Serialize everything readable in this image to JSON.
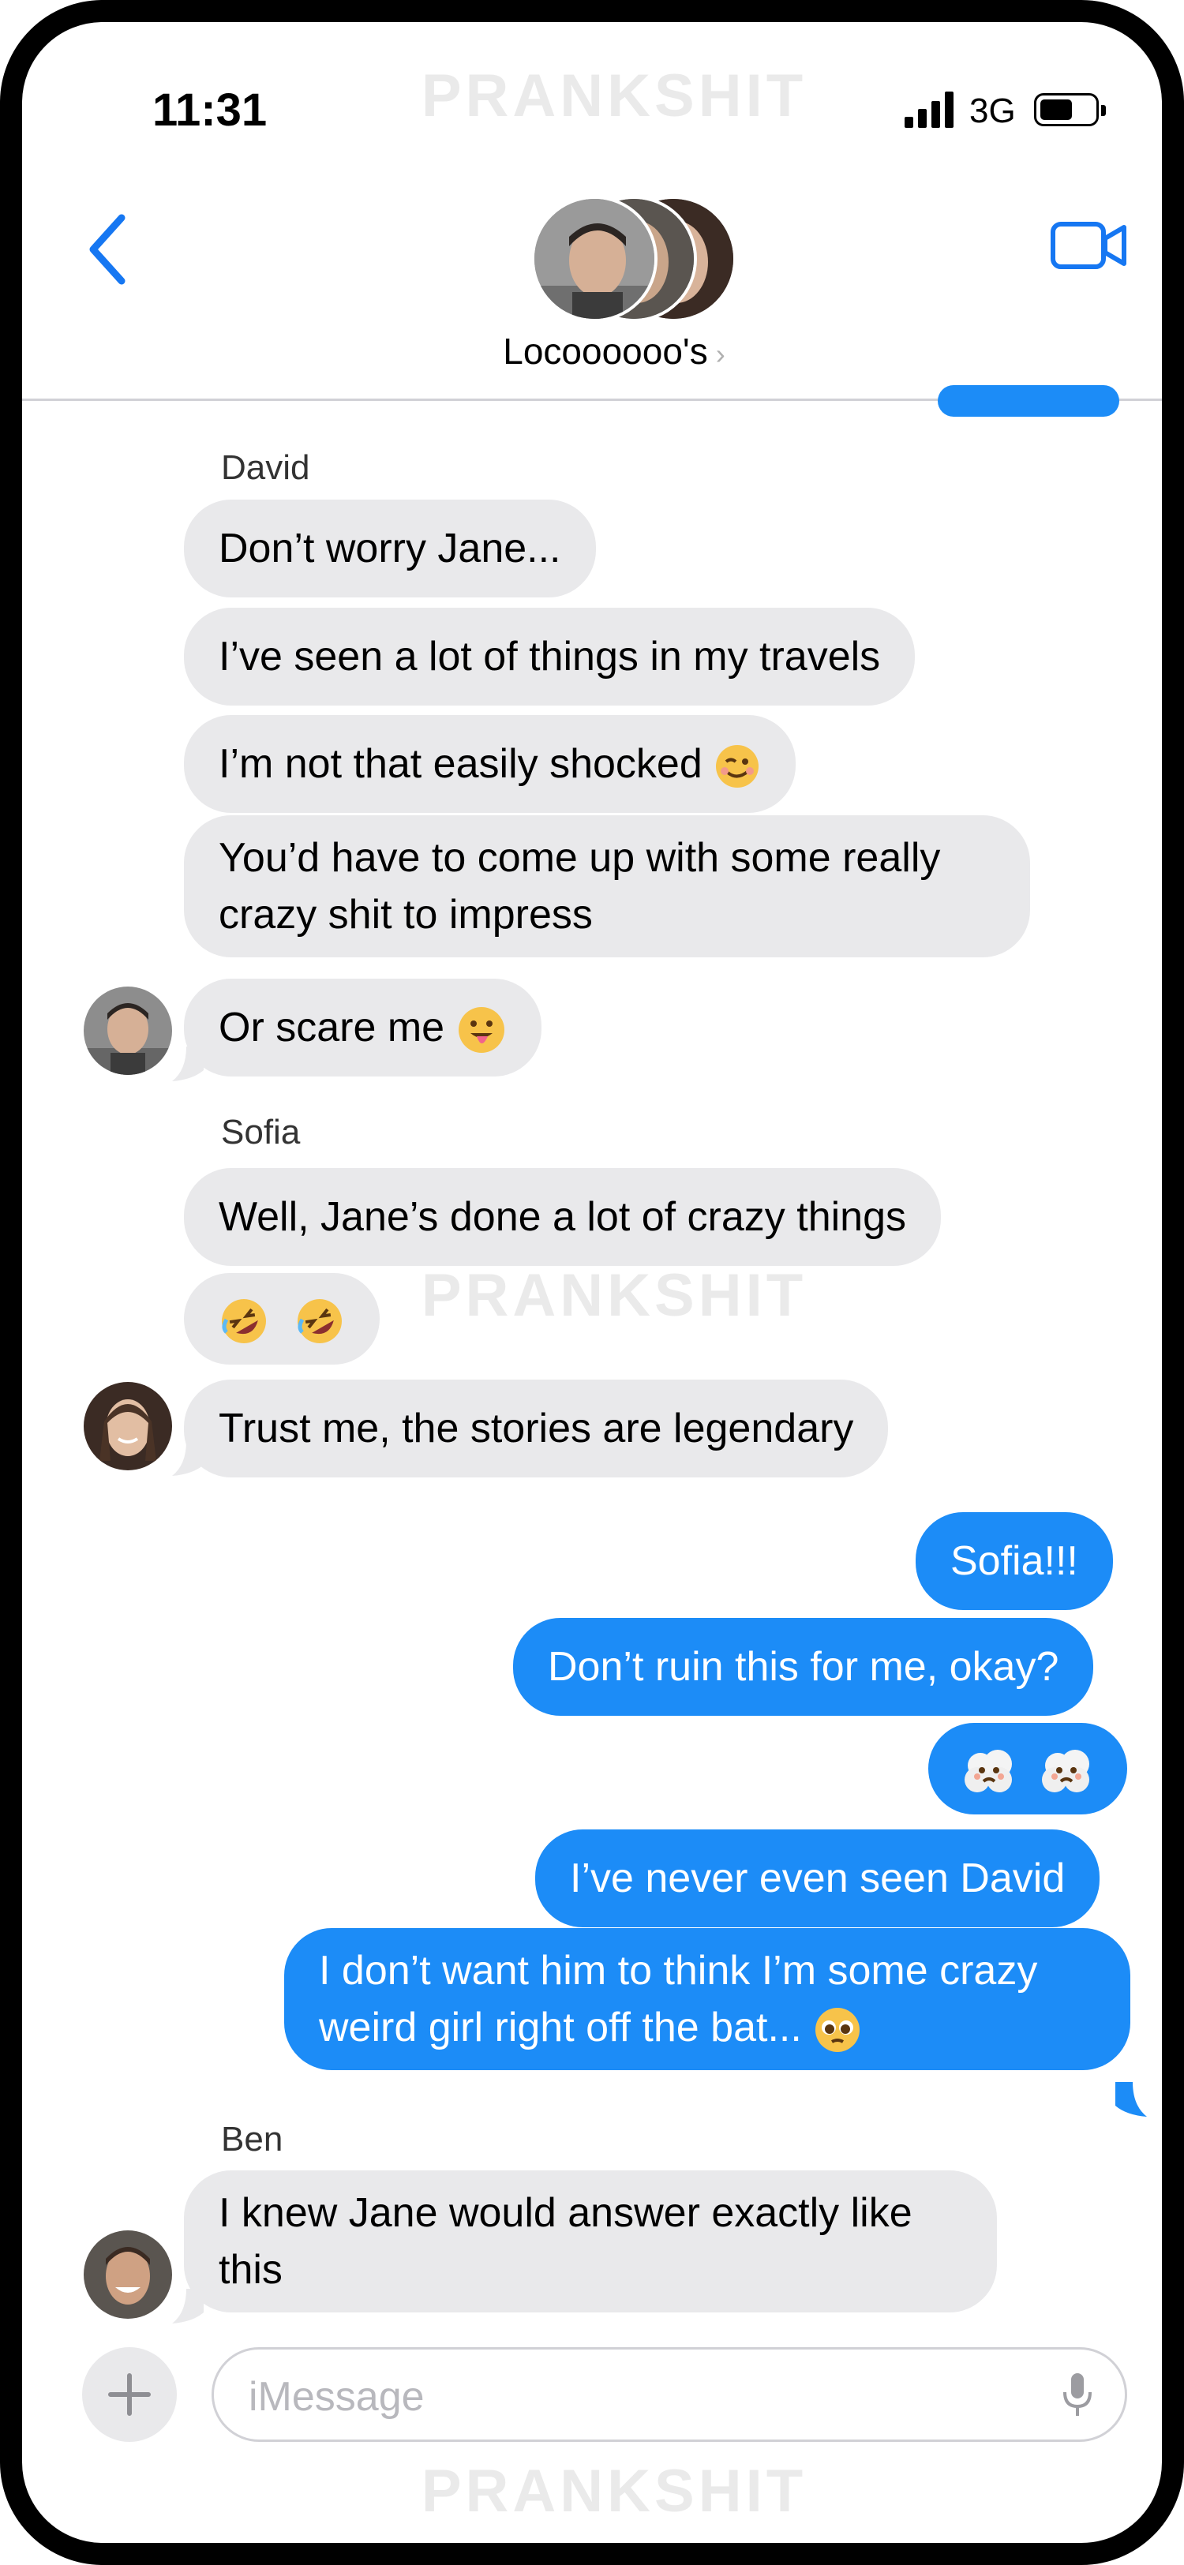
{
  "status": {
    "time": "11:31",
    "network": "3G"
  },
  "watermark": "PRANKSHIT",
  "header": {
    "title": "Locoooooo's"
  },
  "messages": {
    "david_name": "David",
    "m1": "Don’t worry Jane...",
    "m2": "I’ve seen a lot of things in my travels",
    "m3": "I’m not that easily shocked",
    "m4": "You’d have to come up with some really crazy shit to impress",
    "m5": "Or scare me",
    "sofia_name": "Sofia",
    "m6": "Well, Jane’s done a lot of crazy things",
    "m8": "Trust me, the stories are legendary",
    "o1": "Sofia!!!",
    "o2": "Don’t ruin this for me, okay?",
    "o4": "I’ve never even seen David",
    "o5": "I don’t want him to think I’m some crazy weird girl right off the bat...",
    "ben_name": "Ben",
    "m9": "I knew Jane would answer exactly like this"
  },
  "input": {
    "placeholder": "iMessage"
  },
  "colors": {
    "outgoing": "#1c8cf7",
    "incoming": "#e9e9eb",
    "accent": "#1677f2"
  }
}
